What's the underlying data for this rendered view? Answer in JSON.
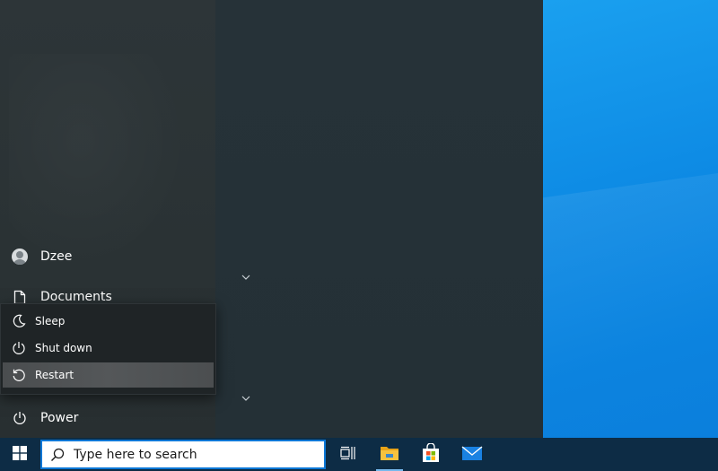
{
  "start_menu": {
    "rail": {
      "user_name": "Dzee",
      "documents_label": "Documents",
      "power_label": "Power"
    },
    "power_flyout": {
      "items": [
        {
          "label": "Sleep",
          "icon": "moon-icon"
        },
        {
          "label": "Shut down",
          "icon": "power-icon"
        },
        {
          "label": "Restart",
          "icon": "restart-icon",
          "selected": true
        }
      ]
    }
  },
  "taskbar": {
    "search_placeholder": "Type here to search",
    "icons": [
      "windows-logo-icon",
      "search-icon",
      "task-view-icon",
      "file-explorer-icon",
      "microsoft-store-icon",
      "mail-icon"
    ]
  },
  "colors": {
    "taskbar_bg": "#0d2c45",
    "desktop_blue": "#0d8ae4",
    "accent": "#0b77d6"
  }
}
